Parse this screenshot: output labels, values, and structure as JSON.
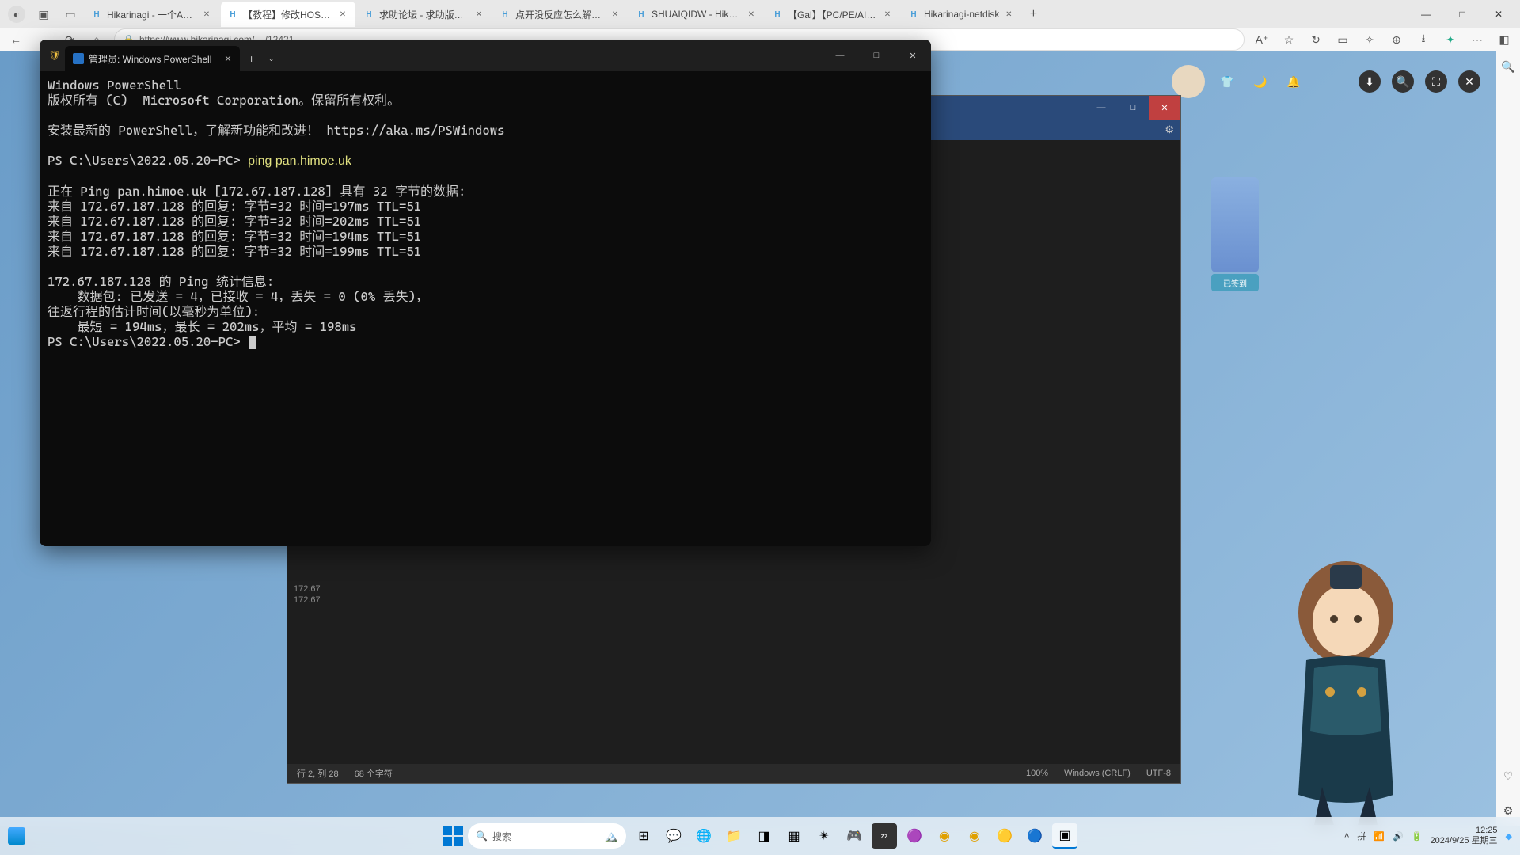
{
  "browser": {
    "tabs": [
      {
        "title": "Hikarinagi - 一个ACGN文化社区"
      },
      {
        "title": "【教程】修改HOSTS，和转圈"
      },
      {
        "title": "求助论坛 - 求助版块 - 我要提问"
      },
      {
        "title": "点开没反应怎么解决 - 求助论"
      },
      {
        "title": "SHUAIQIDW - Hikarinagi"
      },
      {
        "title": "【Gal】【PC/PE/AI汉化】甜蜜"
      },
      {
        "title": "Hikarinagi-netdisk"
      }
    ],
    "active_tab_index": 1,
    "url": "https://www.hikarinagi.com/..../12421",
    "side_badge": "已签到"
  },
  "notepad": {
    "ip_lines": [
      "172.67",
      "172.67"
    ],
    "status": {
      "pos": "行 2, 列 28",
      "chars": "68 个字符",
      "zoom": "100%",
      "eol": "Windows (CRLF)",
      "enc": "UTF-8"
    }
  },
  "terminal": {
    "tab_title": "管理员: Windows PowerShell",
    "lines": [
      "Windows PowerShell",
      "版权所有 (C)  Microsoft Corporation。保留所有权利。",
      "",
      "安装最新的 PowerShell，了解新功能和改进！ https://aka.ms/PSWindows",
      "",
      "PS C:\\Users\\2022.05.20-PC> ",
      "",
      "正在 Ping pan.himoe.uk [172.67.187.128] 具有 32 字节的数据:",
      "来自 172.67.187.128 的回复: 字节=32 时间=197ms TTL=51",
      "来自 172.67.187.128 的回复: 字节=32 时间=202ms TTL=51",
      "来自 172.67.187.128 的回复: 字节=32 时间=194ms TTL=51",
      "来自 172.67.187.128 的回复: 字节=32 时间=199ms TTL=51",
      "",
      "172.67.187.128 的 Ping 统计信息:",
      "    数据包: 已发送 = 4，已接收 = 4，丢失 = 0 (0% 丢失)，",
      "往返行程的估计时间(以毫秒为单位):",
      "    最短 = 194ms，最长 = 202ms，平均 = 198ms",
      "PS C:\\Users\\2022.05.20-PC> "
    ],
    "command": "ping pan.himoe.uk"
  },
  "taskbar": {
    "search_placeholder": "搜索",
    "ime": "拼",
    "time": "12:25",
    "date": "2024/9/25 星期三"
  },
  "icons": {
    "close": "✕",
    "min": "—",
    "max": "□",
    "plus": "+",
    "down": "⌄",
    "back": "←",
    "fwd": "→",
    "reload": "⟳",
    "home": "⌂",
    "lock": "🔒",
    "star": "☆",
    "ext": "⊞",
    "read": "▭",
    "fav": "✧",
    "coll": "⊕",
    "dl": "⭳",
    "more": "⋯",
    "split": "◧",
    "search": "🔍",
    "gear": "⚙",
    "shield": "🛡",
    "heart": "♡",
    "shirt": "👕",
    "moon": "🌙",
    "bell": "🔔",
    "download2": "⬇",
    "expand": "⛶",
    "wifi": "📶",
    "vol": "🔊",
    "bat": "🔋",
    "chev": "˄",
    "refresh2": "↻"
  }
}
